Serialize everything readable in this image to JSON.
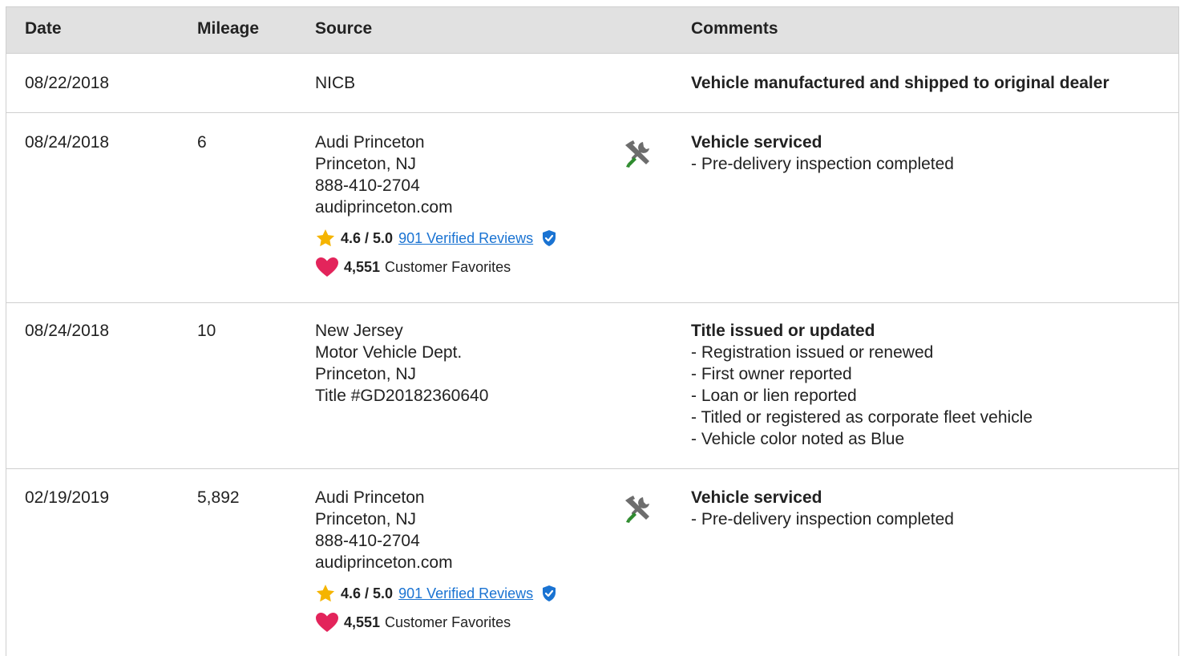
{
  "header": {
    "date": "Date",
    "mileage": "Mileage",
    "source": "Source",
    "comments": "Comments"
  },
  "rows": [
    {
      "date": "08/22/2018",
      "mileage": "",
      "source": [
        "NICB"
      ],
      "comment_title": "Vehicle manufactured and shipped to original dealer",
      "comment_items": []
    },
    {
      "date": "08/24/2018",
      "mileage": "6",
      "source": [
        "Audi Princeton",
        "Princeton, NJ",
        "888-410-2704",
        "audiprinceton.com"
      ],
      "rating": "4.6 / 5.0",
      "reviews_link": "901 Verified Reviews",
      "favorites_count": "4,551",
      "favorites_label": "Customer Favorites",
      "comment_title": "Vehicle serviced",
      "comment_items": [
        "- Pre-delivery inspection completed"
      ]
    },
    {
      "date": "08/24/2018",
      "mileage": "10",
      "source": [
        "New Jersey",
        "Motor Vehicle Dept.",
        "Princeton, NJ",
        "Title #GD20182360640"
      ],
      "comment_title": "Title issued or updated",
      "comment_items": [
        "- Registration issued or renewed",
        "- First owner reported",
        "- Loan or lien reported",
        "- Titled or registered as corporate fleet vehicle",
        "- Vehicle color noted as Blue"
      ]
    },
    {
      "date": "02/19/2019",
      "mileage": "5,892",
      "source": [
        "Audi Princeton",
        "Princeton, NJ",
        "888-410-2704",
        "audiprinceton.com"
      ],
      "rating": "4.6 / 5.0",
      "reviews_link": "901 Verified Reviews",
      "favorites_count": "4,551",
      "favorites_label": "Customer Favorites",
      "comment_title": "Vehicle serviced",
      "comment_items": [
        "- Pre-delivery inspection completed"
      ]
    }
  ],
  "colors": {
    "header_bg": "#e1e1e1",
    "link": "#1a73d2",
    "star": "#f5b400",
    "heart": "#e3245b",
    "verified": "#1a73d2",
    "wrench_handle": "#2e8b2e",
    "tool_gray": "#6d6d6d"
  },
  "icons": {
    "service": "service-tools-icon",
    "star": "star-icon",
    "verified": "verified-badge-icon",
    "heart": "heart-icon"
  }
}
